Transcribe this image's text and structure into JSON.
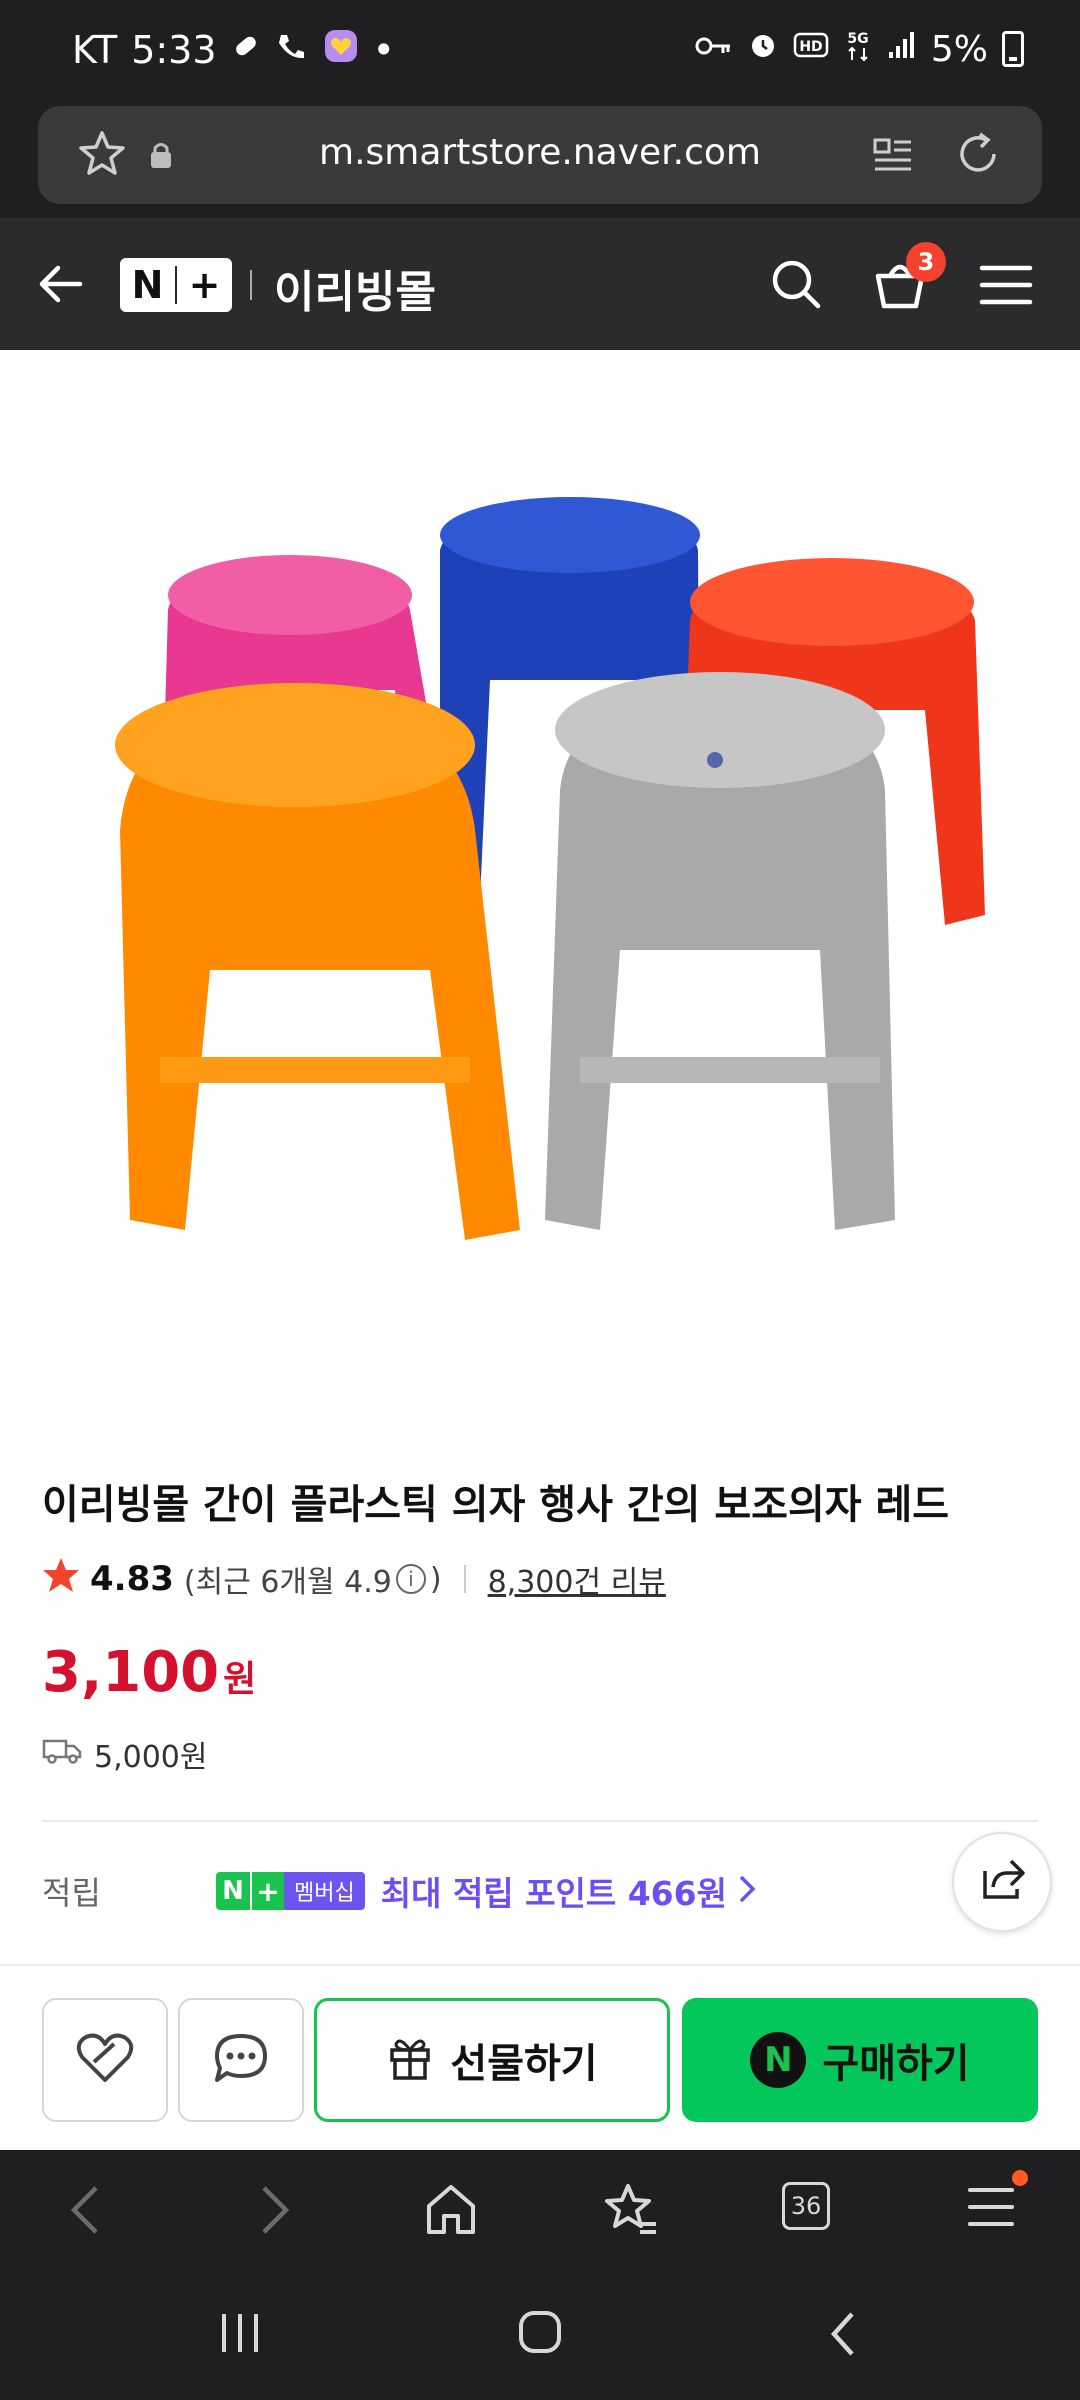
{
  "status_bar": {
    "carrier": "KT",
    "time": "5:33",
    "battery": "5%"
  },
  "browser": {
    "url": "m.smartstore.naver.com",
    "tab_count": "36"
  },
  "store_header": {
    "logo_left": "N",
    "logo_right": "+",
    "store_name": "이리빙몰",
    "cart_count": "3"
  },
  "product": {
    "title": "이리빙몰 간이 플라스틱 의자 행사 간의 보조의자 레드",
    "rating": "4.83",
    "recent_prefix": "(최근 6개월 4.9",
    "recent_suffix": ")",
    "review_count": "8,300건 리뷰",
    "price": "3,100",
    "price_unit": "원",
    "delivery_fee": "5,000원",
    "points_label": "적립",
    "membership_label": "멤버십",
    "points_text": "최대 적립 포인트 466원"
  },
  "actions": {
    "gift_label": "선물하기",
    "buy_label": "구매하기",
    "buy_logo": "N"
  },
  "colors": {
    "price_red": "#d4112e",
    "naver_green": "#03c75a",
    "membership_purple": "#6d53f0",
    "badge_red": "#f3422f"
  },
  "product_image": {
    "stools": [
      "pink",
      "blue",
      "red",
      "orange",
      "gray"
    ]
  }
}
